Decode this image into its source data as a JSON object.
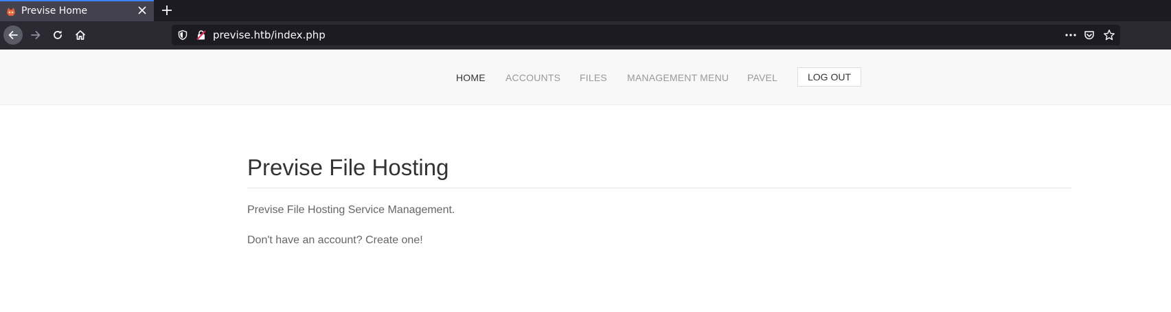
{
  "browser": {
    "tab": {
      "title": "Previse Home",
      "favicon": "previse-favicon-icon"
    },
    "url": "previse.htb/index.php",
    "colors": {
      "tabbar": "#1c1b22",
      "active_tab": "#42414d",
      "toolbar": "#2b2a33",
      "accent": "#3b82f6"
    }
  },
  "site": {
    "nav": {
      "items": [
        {
          "label": "HOME",
          "active": true
        },
        {
          "label": "ACCOUNTS"
        },
        {
          "label": "FILES"
        },
        {
          "label": "MANAGEMENT MENU"
        },
        {
          "label": "PAVEL"
        }
      ],
      "logout_label": "LOG OUT"
    },
    "main": {
      "title": "Previse File Hosting",
      "description": "Previse File Hosting Service Management.",
      "signup_text": "Don't have an account? Create one!"
    },
    "colors": {
      "header_bg": "#f8f8f8",
      "text": "#333333",
      "muted": "#999999"
    }
  }
}
